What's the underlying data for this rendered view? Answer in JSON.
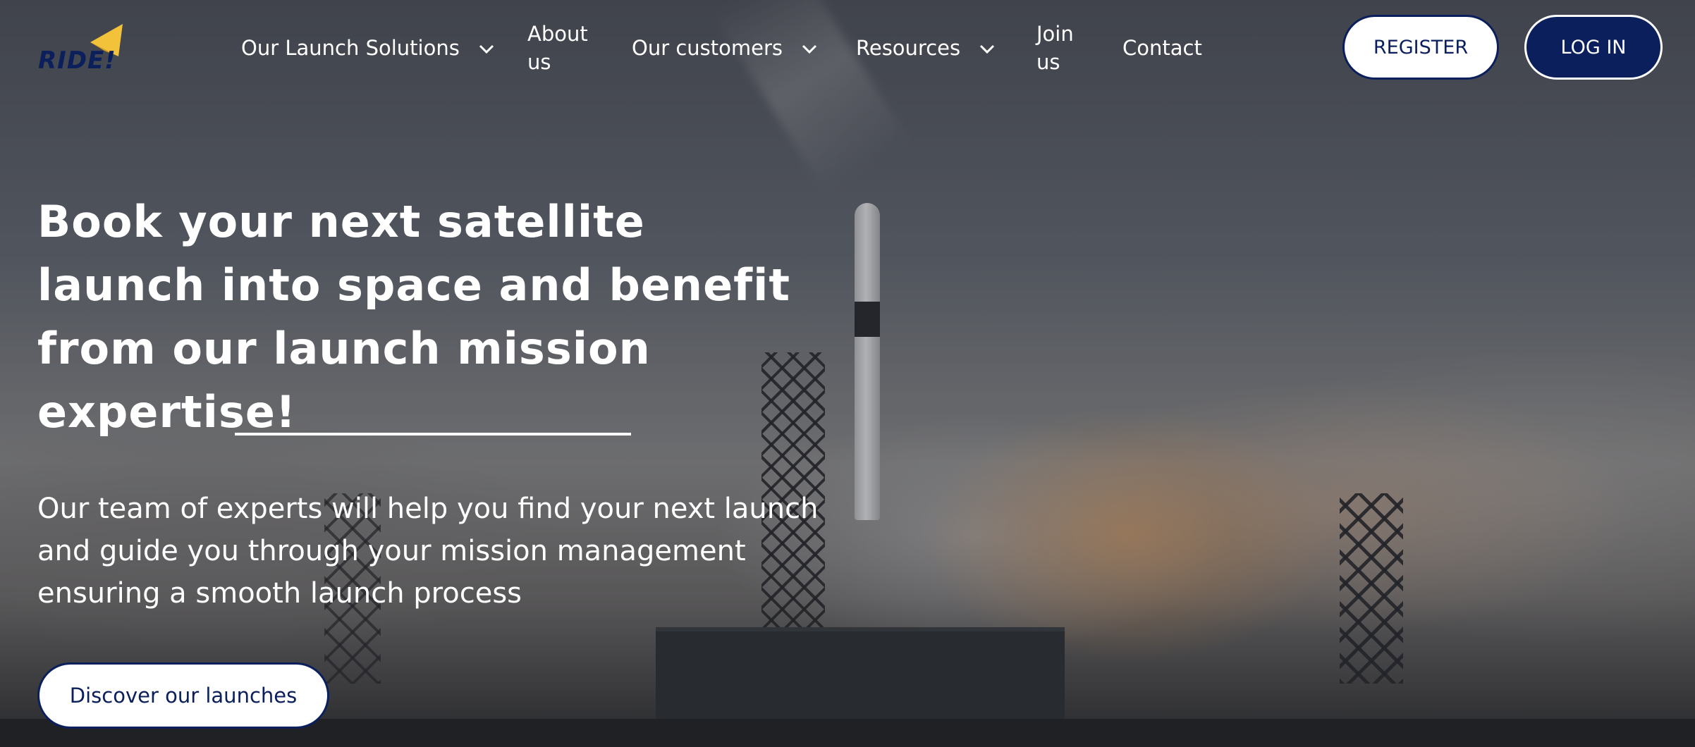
{
  "brand": {
    "logo_text": "RIDE!"
  },
  "nav": {
    "items": [
      {
        "label": "Our Launch Solutions",
        "has_dropdown": true
      },
      {
        "label": "About us",
        "has_dropdown": false
      },
      {
        "label": "Our customers",
        "has_dropdown": true
      },
      {
        "label": "Resources",
        "has_dropdown": true
      },
      {
        "label": "Join us",
        "has_dropdown": false
      },
      {
        "label": "Contact",
        "has_dropdown": false
      }
    ],
    "register_label": "REGISTER",
    "login_label": "LOG IN"
  },
  "hero": {
    "headline": "Book your next satellite launch into space and benefit from our launch mission expertise!",
    "subtext": "Our team of experts will help you find your next launch and guide you through your mission management ensuring a smooth launch process",
    "cta_label": "Discover our launches",
    "background": "rocket-launch-photo"
  },
  "colors": {
    "brand_navy": "#0b1f5c",
    "brand_yellow": "#f2c33a",
    "text_light": "#ffffff"
  }
}
